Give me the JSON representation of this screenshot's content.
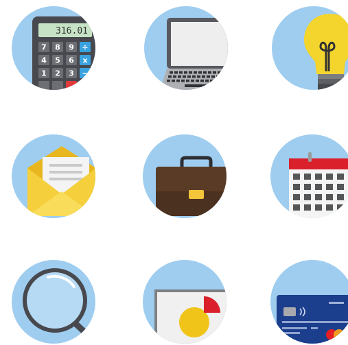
{
  "colors": {
    "circle": "#9ecdf0",
    "calculator_body": "#48494e",
    "display": "#c7e3c5",
    "key": "#6c6e73",
    "key_blue": "#3aa2e1",
    "laptop_screen": "#eeeeee",
    "bulb": "#f3d52e",
    "envelope": "#f5cf3c",
    "briefcase": "#5a3c26",
    "calendar_header": "#d9202b",
    "card": "#1b3e8d"
  },
  "calculator": {
    "display": "316.01",
    "keys": [
      "7",
      "8",
      "9",
      "÷",
      "4",
      "5",
      "6",
      "x",
      "1",
      "2",
      "3",
      "−"
    ]
  },
  "icons": [
    {
      "name": "calculator-icon"
    },
    {
      "name": "laptop-icon"
    },
    {
      "name": "lightbulb-icon"
    },
    {
      "name": "envelope-icon"
    },
    {
      "name": "briefcase-icon"
    },
    {
      "name": "calendar-icon"
    },
    {
      "name": "magnifier-icon"
    },
    {
      "name": "chart-report-icon"
    },
    {
      "name": "credit-card-icon"
    }
  ]
}
